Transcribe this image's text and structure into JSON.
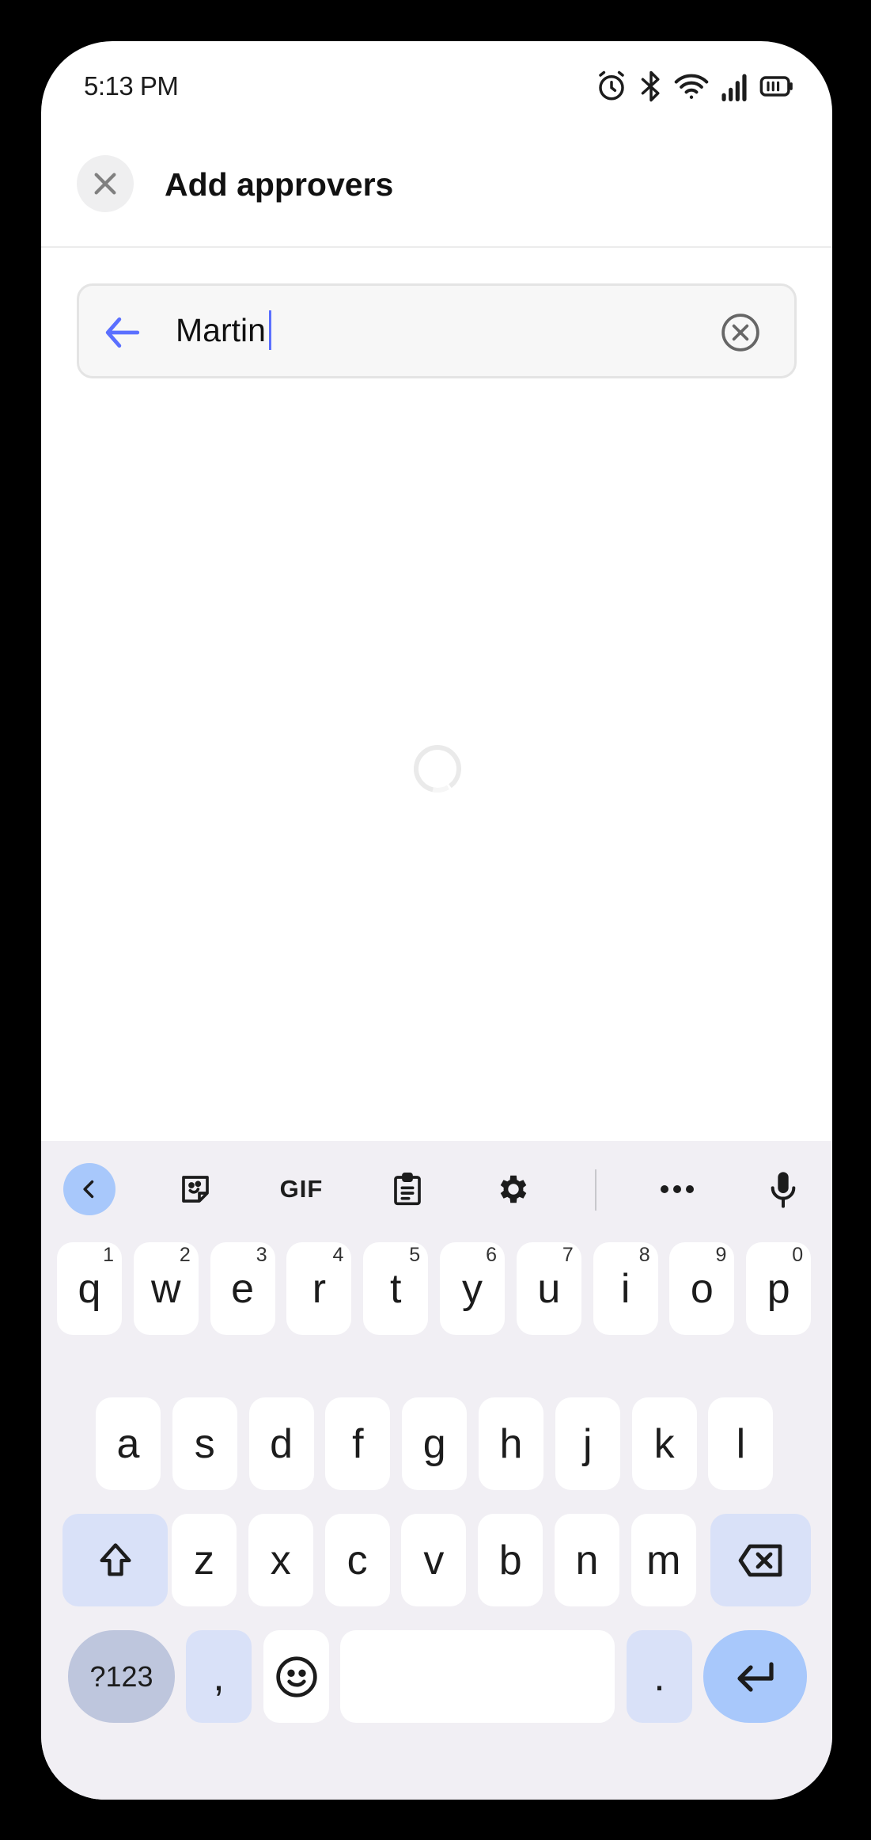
{
  "status_bar": {
    "time": "5:13 PM",
    "icons": [
      "alarm-icon",
      "bluetooth-icon",
      "wifi-icon",
      "signal-icon",
      "battery-icon"
    ]
  },
  "header": {
    "title": "Add approvers",
    "close_icon": "close-icon"
  },
  "search": {
    "value": "Martin",
    "back_icon": "arrow-left-icon",
    "clear_icon": "clear-circle-icon",
    "accent_color": "#5b70ff"
  },
  "content": {
    "state": "loading"
  },
  "keyboard": {
    "toolbar": {
      "items": [
        "chevron-left-icon",
        "sticker-icon",
        "GIF",
        "clipboard-icon",
        "settings-icon",
        "more-icon",
        "mic-icon"
      ],
      "gif_label": "GIF"
    },
    "row1": [
      {
        "key": "q",
        "hint": "1"
      },
      {
        "key": "w",
        "hint": "2"
      },
      {
        "key": "e",
        "hint": "3"
      },
      {
        "key": "r",
        "hint": "4"
      },
      {
        "key": "t",
        "hint": "5"
      },
      {
        "key": "y",
        "hint": "6"
      },
      {
        "key": "u",
        "hint": "7"
      },
      {
        "key": "i",
        "hint": "8"
      },
      {
        "key": "o",
        "hint": "9"
      },
      {
        "key": "p",
        "hint": "0"
      }
    ],
    "row2": [
      "a",
      "s",
      "d",
      "f",
      "g",
      "h",
      "j",
      "k",
      "l"
    ],
    "row3": [
      "z",
      "x",
      "c",
      "v",
      "b",
      "n",
      "m"
    ],
    "row4": {
      "symbols": "?123",
      "comma": ",",
      "period": "."
    },
    "colors": {
      "background": "#f1eff4",
      "key": "#ffffff",
      "modifier": "#d9e1f8",
      "accent": "#a8c8fb",
      "symbols": "#bec6dd"
    }
  }
}
